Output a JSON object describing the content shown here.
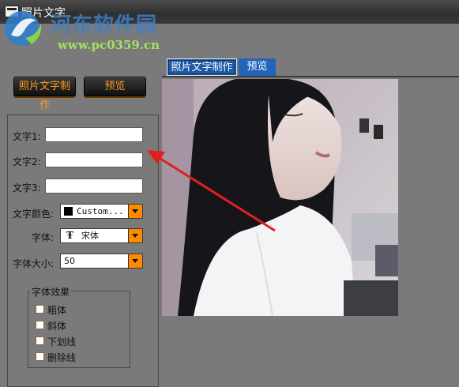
{
  "window": {
    "title": "照片文字"
  },
  "watermark": {
    "site_name": "河东软件园",
    "url": "www.pc0359.cn"
  },
  "toolbar": {
    "make_label": "照片文字制作",
    "preview_label": "预览"
  },
  "tabs": [
    {
      "label": "照片文字制作",
      "active": true
    },
    {
      "label": "预览",
      "active": false
    }
  ],
  "form": {
    "text1_label": "文字1:",
    "text2_label": "文字2:",
    "text3_label": "文字3:",
    "text1_value": "",
    "text2_value": "",
    "text3_value": "",
    "color_label": "文字颜色:",
    "color_value": "Custom...",
    "color_swatch": "#000000",
    "font_label": "字体:",
    "font_value": "宋体",
    "font_icon": "truetype-icon",
    "size_label": "字体大小:",
    "size_value": "50"
  },
  "effects": {
    "title": "字体效果",
    "items": [
      {
        "label": "粗体",
        "checked": false
      },
      {
        "label": "斜体",
        "checked": false
      },
      {
        "label": "下划线",
        "checked": false
      },
      {
        "label": "删除线",
        "checked": false
      }
    ]
  },
  "colors": {
    "accent_orange": "#ff8a00",
    "tab_blue": "#1d5aa8",
    "background": "#7a7a7a",
    "annotation_arrow": "#e02020"
  }
}
